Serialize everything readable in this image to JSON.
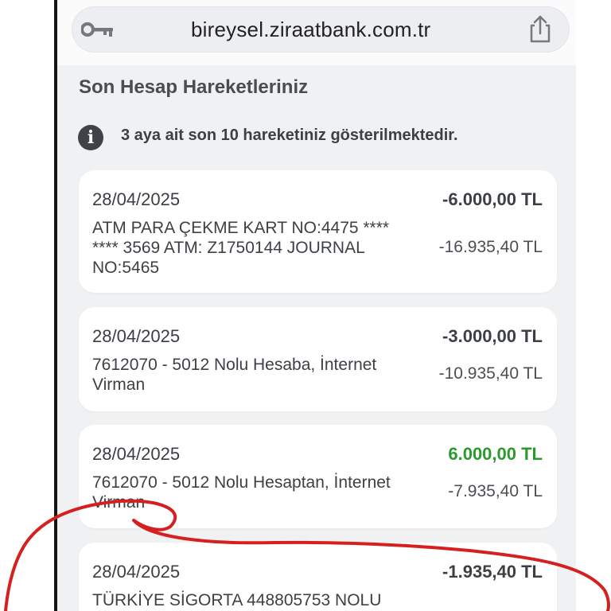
{
  "browser": {
    "url": "bireysel.ziraatbank.com.tr",
    "lock_icon": "key-icon",
    "share_icon": "share-icon"
  },
  "section": {
    "title": "Son Hesap Hareketleriniz",
    "info_icon": "info-icon",
    "info_text": "3 aya ait son 10 hareketiniz gösterilmektedir."
  },
  "transactions": [
    {
      "date": "28/04/2025",
      "description": "ATM PARA ÇEKME KART NO:4475 **** **** 3569 ATM: Z1750144 JOURNAL NO:5465",
      "amount": "-6.000,00 TL",
      "balance": "-16.935,40 TL"
    },
    {
      "date": "28/04/2025",
      "description": "7612070 - 5012 Nolu Hesaba, İnternet Virman",
      "amount": "-3.000,00 TL",
      "balance": "-10.935,40 TL"
    },
    {
      "date": "28/04/2025",
      "description": "7612070 - 5012 Nolu Hesaptan, İnternet Virman",
      "amount": "6.000,00 TL",
      "balance": "-7.935,40 TL"
    },
    {
      "date": "28/04/2025",
      "description": "TÜRKİYE SİGORTA 448805753 NOLU",
      "amount": "-1.935,40 TL",
      "balance": ""
    }
  ],
  "colors": {
    "positive_amount": "#2b9a2d",
    "annotation": "#d6201f"
  }
}
